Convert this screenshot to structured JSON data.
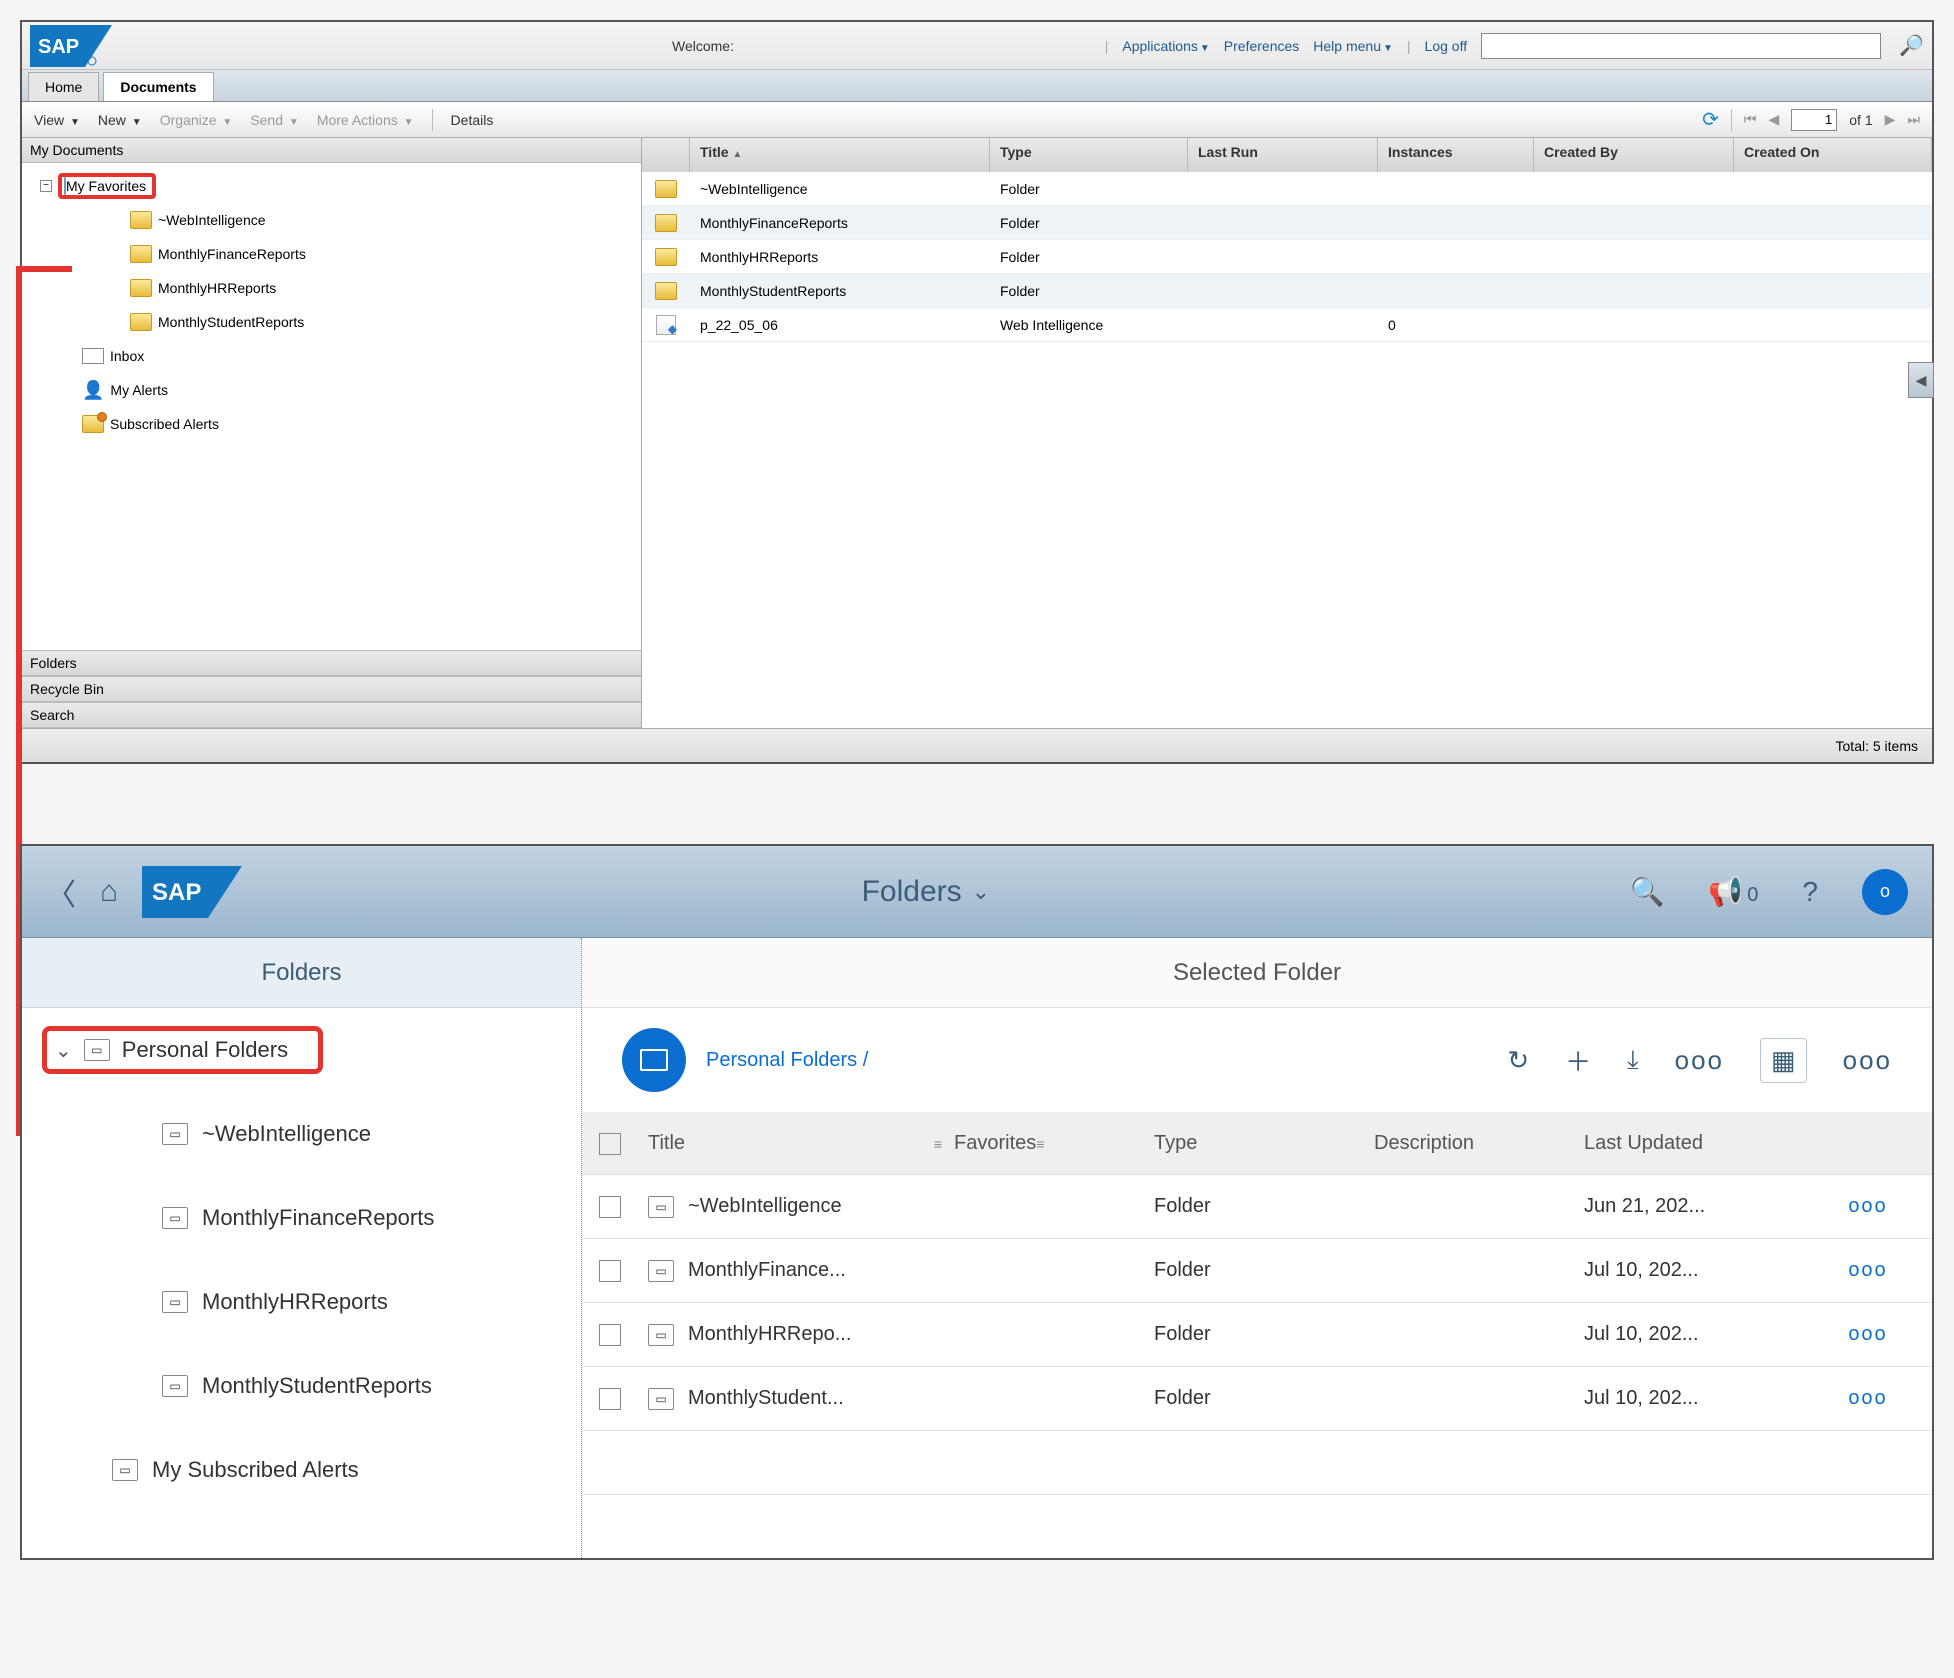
{
  "old": {
    "welcome": "Welcome:",
    "toplinks": {
      "applications": "Applications",
      "preferences": "Preferences",
      "help": "Help menu",
      "logoff": "Log off"
    },
    "tabs": {
      "home": "Home",
      "documents": "Documents"
    },
    "toolbar": {
      "view": "View",
      "new": "New",
      "organize": "Organize",
      "send": "Send",
      "more": "More Actions",
      "details": "Details"
    },
    "pager": {
      "page": "1",
      "of": "of 1"
    },
    "tree": {
      "mydocs": "My Documents",
      "favorites": "My Favorites",
      "items": [
        "~WebIntelligence",
        "MonthlyFinanceReports",
        "MonthlyHRReports",
        "MonthlyStudentReports"
      ],
      "inbox": "Inbox",
      "myalerts": "My Alerts",
      "subscribed": "Subscribed Alerts"
    },
    "sections": {
      "folders": "Folders",
      "recycle": "Recycle Bin",
      "search": "Search"
    },
    "columns": {
      "title": "Title",
      "type": "Type",
      "lastrun": "Last Run",
      "instances": "Instances",
      "createdby": "Created By",
      "createdon": "Created On"
    },
    "rows": [
      {
        "title": "~WebIntelligence",
        "type": "Folder",
        "instances": ""
      },
      {
        "title": "MonthlyFinanceReports",
        "type": "Folder",
        "instances": ""
      },
      {
        "title": "MonthlyHRReports",
        "type": "Folder",
        "instances": ""
      },
      {
        "title": "MonthlyStudentReports",
        "type": "Folder",
        "instances": ""
      },
      {
        "title": "p_22_05_06",
        "type": "Web Intelligence",
        "instances": "0"
      }
    ],
    "footer": "Total: 5 items"
  },
  "new": {
    "title": "Folders",
    "megaphone_badge": "0",
    "avatar": "o",
    "tree_title": "Folders",
    "personal": "Personal Folders",
    "tree_items": [
      "~WebIntelligence",
      "MonthlyFinanceReports",
      "MonthlyHRReports",
      "MonthlyStudentReports"
    ],
    "subscribed": "My Subscribed Alerts",
    "main_title": "Selected Folder",
    "breadcrumb": {
      "link": "Personal Folders",
      "slash": "/"
    },
    "columns": {
      "title": "Title",
      "favorites": "Favorites",
      "type": "Type",
      "description": "Description",
      "updated": "Last Updated"
    },
    "rows": [
      {
        "title": "~WebIntelligence",
        "type": "Folder",
        "updated": "Jun 21, 202..."
      },
      {
        "title": "MonthlyFinance...",
        "type": "Folder",
        "updated": "Jul 10, 202..."
      },
      {
        "title": "MonthlyHRRepo...",
        "type": "Folder",
        "updated": "Jul 10, 202..."
      },
      {
        "title": "MonthlyStudent...",
        "type": "Folder",
        "updated": "Jul 10, 202..."
      }
    ]
  }
}
